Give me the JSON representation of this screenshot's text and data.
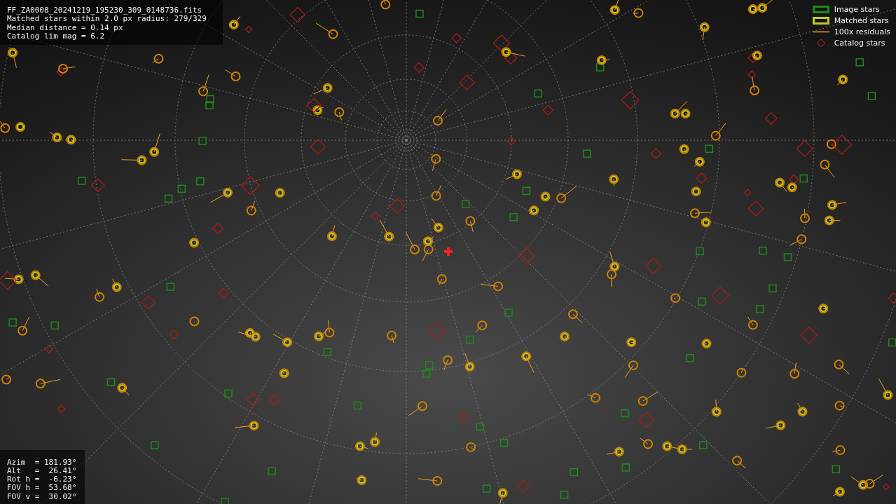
{
  "info_box": {
    "lines": [
      "FF_ZA0008_20241219_195230_309_0148736.fits",
      "Matched stars within 2.0 px radius: 279/329",
      "Median distance = 0.14 px",
      "Catalog lim mag = 6.2"
    ]
  },
  "legend": [
    {
      "kind": "image",
      "label": "Image stars"
    },
    {
      "kind": "matched",
      "label": "Matched stars"
    },
    {
      "kind": "residual",
      "label": "100x residuals"
    },
    {
      "kind": "catalog",
      "label": "Catalog stars"
    }
  ],
  "pointing_box": {
    "lines": [
      "Azim  = 181.93°",
      "Alt   =  26.41°",
      "Rot h =  -6.23°",
      "FOV h =  53.68°",
      "FOV v =  30.02°"
    ]
  }
}
